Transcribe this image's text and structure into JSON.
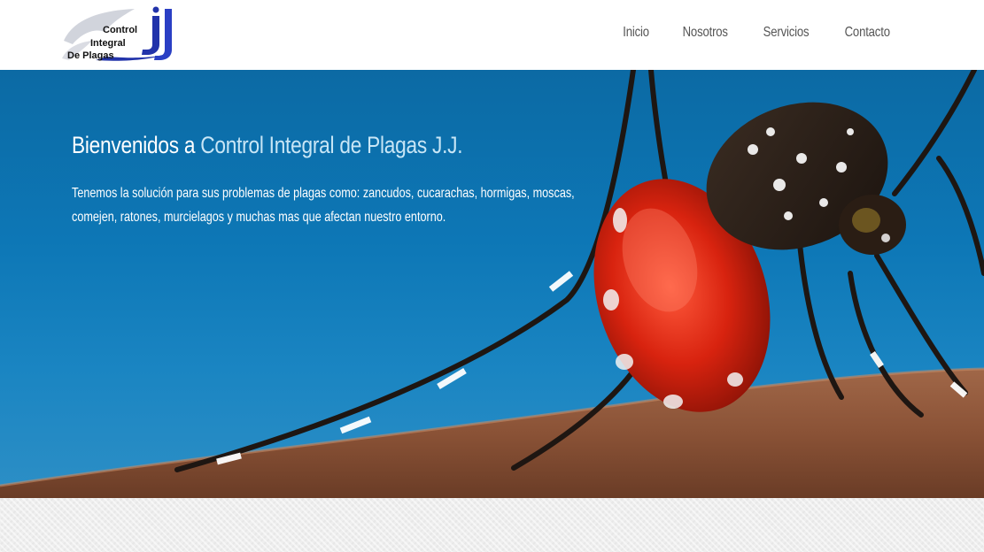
{
  "header": {
    "logo": {
      "line1": "Control",
      "line2": "Integral",
      "line3": "De Plagas",
      "mark": "J.J"
    },
    "nav": [
      {
        "label": "Inicio"
      },
      {
        "label": "Nosotros"
      },
      {
        "label": "Servicios"
      },
      {
        "label": "Contacto"
      }
    ]
  },
  "hero": {
    "title_prefix": "Bienvenidos a ",
    "title_accent": "Control Integral de Plagas J.J.",
    "text_line1": "Tenemos la solución para sus problemas de plagas como: zancudos, cucarachas, hormigas, moscas,",
    "text_line2": "comejen, ratones, murcielagos y muchas mas que afectan nuestro entorno.",
    "image_icon": "mosquito-photo"
  },
  "colors": {
    "sky_blue": "#0d77b6",
    "logo_blue": "#2233aa",
    "nav_text": "#555555",
    "title_accent": "#c8e6f6"
  }
}
